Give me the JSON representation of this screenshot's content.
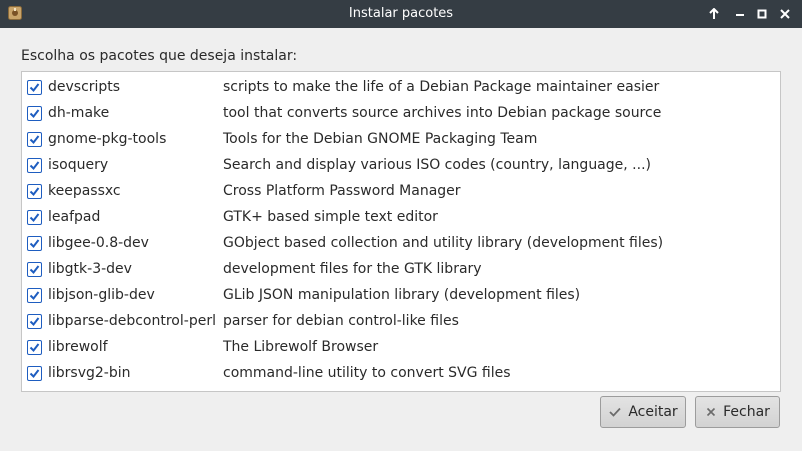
{
  "window": {
    "title": "Instalar pacotes"
  },
  "prompt": "Escolha os pacotes que deseja instalar:",
  "packages": [
    {
      "name": "devscripts",
      "description": "scripts to make the life of a Debian Package maintainer easier",
      "checked": true
    },
    {
      "name": "dh-make",
      "description": "tool that converts source archives into Debian package source",
      "checked": true
    },
    {
      "name": "gnome-pkg-tools",
      "description": "Tools for the Debian GNOME Packaging Team",
      "checked": true
    },
    {
      "name": "isoquery",
      "description": "Search and display various ISO codes (country, language, ...)",
      "checked": true
    },
    {
      "name": "keepassxc",
      "description": "Cross Platform Password Manager",
      "checked": true
    },
    {
      "name": "leafpad",
      "description": "GTK+ based simple text editor",
      "checked": true
    },
    {
      "name": "libgee-0.8-dev",
      "description": "GObject based collection and utility library (development files)",
      "checked": true
    },
    {
      "name": "libgtk-3-dev",
      "description": "development files for the GTK library",
      "checked": true
    },
    {
      "name": "libjson-glib-dev",
      "description": "GLib JSON manipulation library (development files)",
      "checked": true
    },
    {
      "name": "libparse-debcontrol-perl",
      "description": "parser for debian control-like files",
      "checked": true
    },
    {
      "name": "librewolf",
      "description": "The Librewolf Browser",
      "checked": true
    },
    {
      "name": "librsvg2-bin",
      "description": "command-line utility to convert SVG files",
      "checked": true
    }
  ],
  "buttons": {
    "accept_label": "Aceitar",
    "close_label": "Fechar"
  },
  "colors": {
    "titlebar": "#353d44",
    "checkbox_accent": "#1e5dc0"
  }
}
